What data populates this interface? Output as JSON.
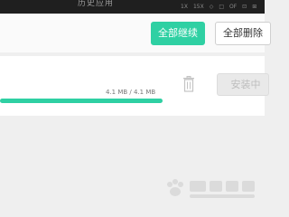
{
  "header": {
    "title": "历史应用",
    "status_icons": [
      "1X",
      "15X",
      "◇",
      "□",
      "OF",
      "⊡",
      "⊞"
    ]
  },
  "toolbar": {
    "continue_all_label": "全部继续",
    "delete_all_label": "全部删除"
  },
  "download_item": {
    "size_text": "4.1 MB / 4.1 MB",
    "progress": 1.0,
    "install_label": "安装中"
  },
  "colors": {
    "accent": "#2fd0a3",
    "header_bg": "#1f1f1f",
    "page_bg": "#efefef"
  },
  "watermark": {
    "icon": "baidu-paw-logo"
  }
}
